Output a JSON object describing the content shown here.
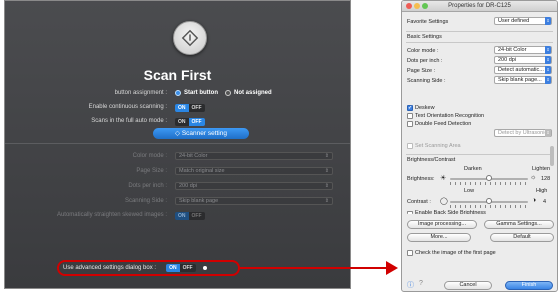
{
  "left": {
    "title": "Scan First",
    "button_assignment": {
      "label": "button assignment :",
      "opt1": "Start button",
      "opt2": "Not assigned"
    },
    "continuous": {
      "label": "Enable continuous scanning :",
      "on": "ON",
      "off": "OFF"
    },
    "auto_mode": {
      "label": "Scans in the full auto mode :",
      "on": "ON",
      "off": "OFF"
    },
    "scanner_setting": "Scanner setting",
    "color_mode": {
      "label": "Color mode :",
      "value": "24-bit Color"
    },
    "page_size": {
      "label": "Page Size :",
      "value": "Match original size"
    },
    "dpi": {
      "label": "Dots per inch :",
      "value": "200 dpi"
    },
    "scanning_side": {
      "label": "Scanning Side :",
      "value": "Skip blank page"
    },
    "straighten": {
      "label": "Automatically straighten skewed images :",
      "on": "ON",
      "off": "OFF"
    },
    "adv": {
      "label": "Use advanced settings dialog box :",
      "on": "ON",
      "off": "OFF"
    }
  },
  "window": {
    "title": "Properties for DR-C125",
    "favorite": {
      "label": "Favorite Settings",
      "value": "User defined"
    },
    "basic_settings": "Basic Settings",
    "color_mode": {
      "label": "Color mode :",
      "value": "24-bit Color"
    },
    "dpi": {
      "label": "Dots per inch :",
      "value": "200 dpi"
    },
    "page_size": {
      "label": "Page Size :",
      "value": "Detect automatic..."
    },
    "scanning_side": {
      "label": "Scanning Side :",
      "value": "Skip blank page..."
    },
    "deskew": "Deskew",
    "text_orientation": "Text Orientation Recognition",
    "double_feed": "Double Feed Detection",
    "detect_by": "Detect by Ultrasonic",
    "set_scanning_area": "Set Scanning Area",
    "brightness_contrast": "Brightness/Contrast",
    "darken": "Darken",
    "lighten": "Lighten",
    "brightness": {
      "label": "Brightness:",
      "value": "128"
    },
    "low": "Low",
    "high": "High",
    "contrast": {
      "label": "Contrast :",
      "value": "4"
    },
    "back_side": "Enable Back Side Brightness",
    "image_processing": "Image processing...",
    "gamma_settings": "Gamma Settings...",
    "more": "More...",
    "default": "Default",
    "check_first": "Check the image of the first page",
    "cancel": "Cancel",
    "finish": "Finish"
  }
}
